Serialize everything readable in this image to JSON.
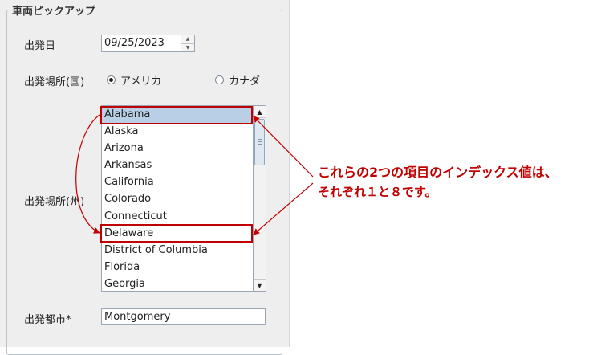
{
  "group": {
    "title": "車両ピックアップ"
  },
  "form": {
    "departure_date_label": "出発日",
    "departure_date_value": "09/25/2023",
    "country_label": "出発場所(国)",
    "country_options": [
      {
        "label": "アメリカ",
        "selected": true
      },
      {
        "label": "カナダ",
        "selected": false
      }
    ],
    "state_label": "出発場所(州)",
    "states": [
      "Alabama",
      "Alaska",
      "Arizona",
      "Arkansas",
      "California",
      "Colorado",
      "Connecticut",
      "Delaware",
      "District of Columbia",
      "Florida",
      "Georgia"
    ],
    "selected_state": "Alabama",
    "city_label": "出発都市*",
    "city_value": "Montgomery"
  },
  "annotation": {
    "line1": "これらの2つの項目のインデックス値は、",
    "line2": "それぞれ１と８です。"
  },
  "colors": {
    "highlight": "#c00000",
    "selection": "#b8cfe5"
  },
  "icons": [
    "spinner-up-icon",
    "spinner-down-icon",
    "scroll-up-icon",
    "scroll-down-icon"
  ]
}
